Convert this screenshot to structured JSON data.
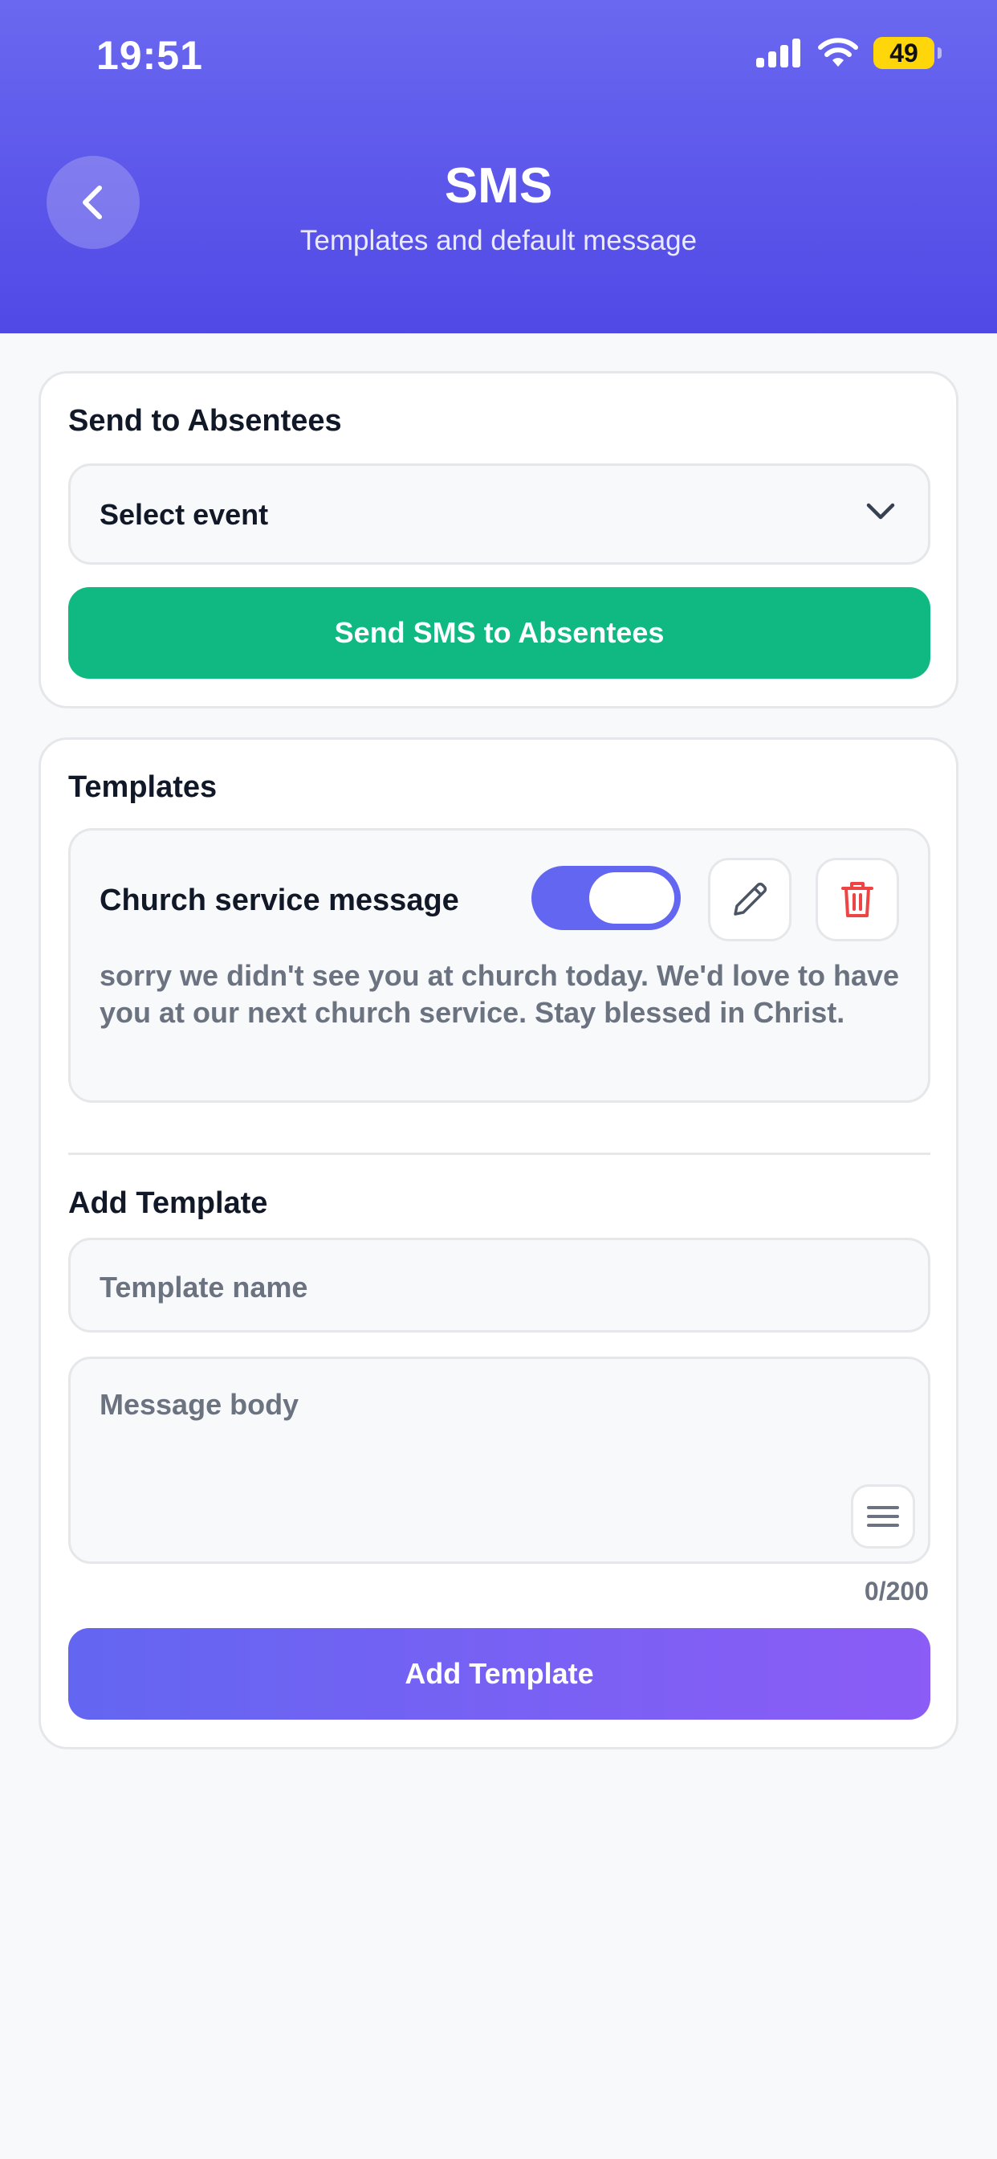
{
  "status_bar": {
    "time": "19:51",
    "battery": "49"
  },
  "header": {
    "title": "SMS",
    "subtitle": "Templates and default message"
  },
  "absentees": {
    "title": "Send to Absentees",
    "select_value": "Select event",
    "send_label": "Send SMS to Absentees"
  },
  "templates": {
    "title": "Templates",
    "items": [
      {
        "name": "Church service message",
        "enabled": true,
        "body": "sorry we didn't see you at church today. We'd love to have you at our next church service. Stay blessed in Christ."
      }
    ]
  },
  "add_template": {
    "title": "Add Template",
    "name_placeholder": "Template name",
    "body_placeholder": "Message body",
    "counter": "0/200",
    "button_label": "Add Template"
  },
  "colors": {
    "header_start": "#6a68f0",
    "header_end": "#5149e6",
    "send_button": "#10b981",
    "toggle_on": "#6366f1",
    "delete_icon": "#ef4444",
    "add_button_start": "#6366f1",
    "add_button_end": "#8b5cf6"
  }
}
